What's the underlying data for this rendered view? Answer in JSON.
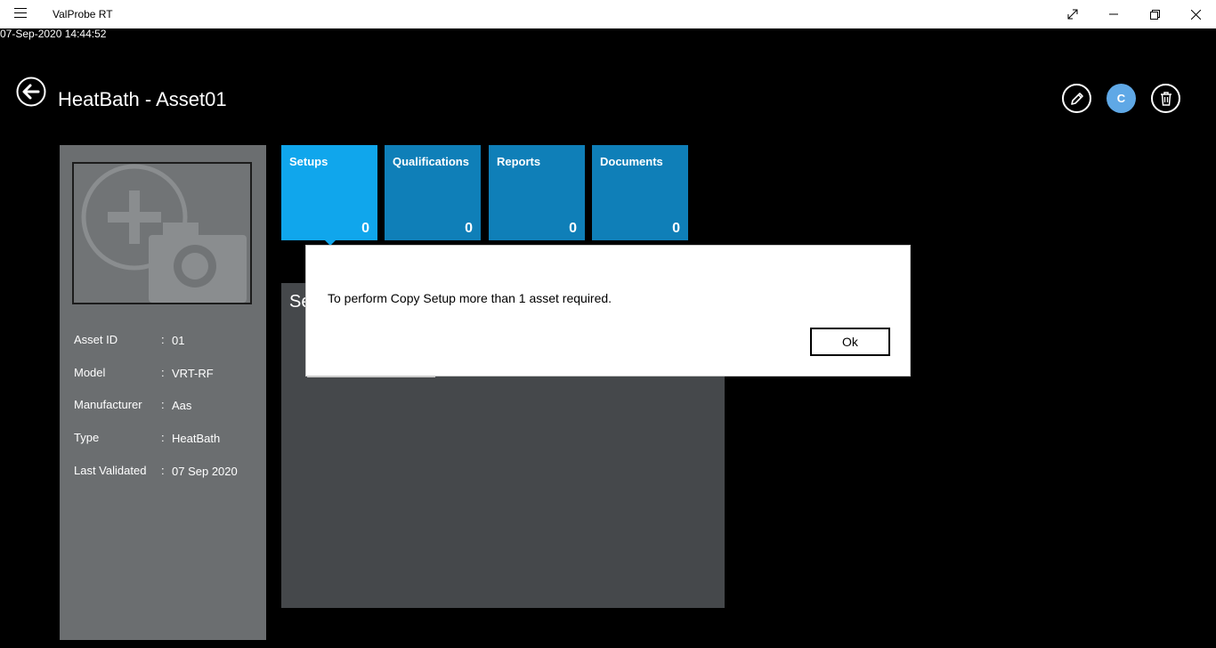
{
  "window": {
    "app_title": "ValProbe RT",
    "controls": [
      "menu-icon",
      "expand-icon",
      "minimize-icon",
      "restore-icon",
      "close-icon"
    ]
  },
  "timestamp": "07-Sep-2020 14:44:52",
  "header": {
    "title": "HeatBath - Asset01",
    "avatar_letter": "C",
    "icons": [
      "back-arrow-icon",
      "edit-pencil-icon",
      "delete-trash-icon"
    ],
    "avatar_color": "#5fa8e6"
  },
  "asset_panel": {
    "photo_placeholder_icon": "add-camera-icon",
    "fields": [
      {
        "label": "Asset ID",
        "separator": ":",
        "value": "01"
      },
      {
        "label": "Model",
        "separator": ":",
        "value": "VRT-RF"
      },
      {
        "label": "Manufacturer",
        "separator": ":",
        "value": "Aas"
      },
      {
        "label": "Type",
        "separator": ":",
        "value": "HeatBath"
      },
      {
        "label": "Last Validated",
        "separator": ":",
        "value": "07 Sep 2020"
      }
    ]
  },
  "tiles": [
    {
      "label": "Setups",
      "count": "0",
      "active": true
    },
    {
      "label": "Qualifications",
      "count": "0",
      "active": false
    },
    {
      "label": "Reports",
      "count": "0",
      "active": false
    },
    {
      "label": "Documents",
      "count": "0",
      "active": false
    }
  ],
  "content": {
    "heading_partial": "Se"
  },
  "dialog": {
    "message": "To perform Copy Setup more than 1 asset required.",
    "ok_label": "Ok"
  },
  "colors": {
    "tile_active": "#10a6ec",
    "tile_default": "#0f7fb8",
    "panel_left": "#6b6e70",
    "panel_content": "#45484b"
  }
}
